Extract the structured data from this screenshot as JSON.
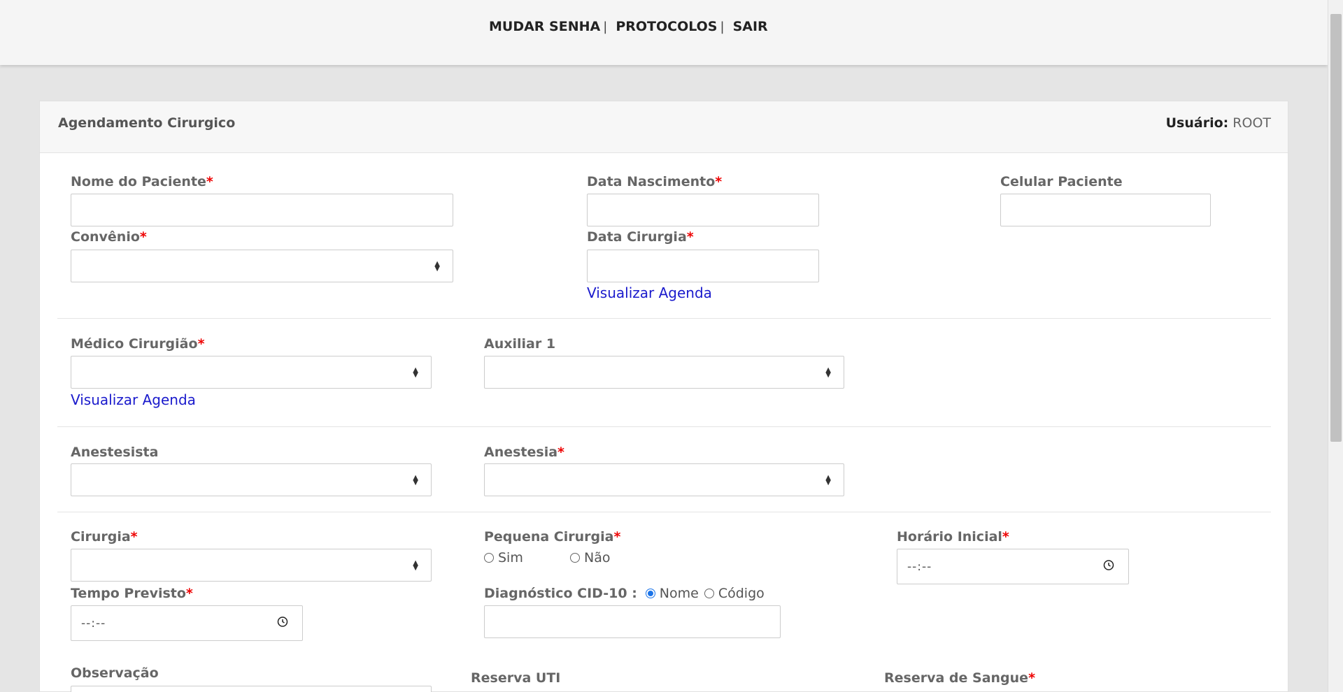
{
  "nav": {
    "change_password": "MUDAR SENHA",
    "protocols": "PROTOCOLOS",
    "logout": "SAIR",
    "separator": "|"
  },
  "header": {
    "title": "Agendamento Cirurgico",
    "user_label": "Usuário:",
    "user_value": "ROOT"
  },
  "form": {
    "patient_name": "Nome do Paciente",
    "birth_date": "Data Nascimento",
    "patient_phone": "Celular Paciente",
    "insurance": "Convênio",
    "surgery_date": "Data Cirurgia",
    "view_schedule_1": "Visualizar Agenda",
    "surgeon": "Médico Cirurgião",
    "assistant1": "Auxiliar 1",
    "view_schedule_2": "Visualizar Agenda",
    "anesthetist": "Anestesista",
    "anesthesia": "Anestesia",
    "surgery": "Cirurgia",
    "minor_surgery": "Pequena Cirurgia",
    "minor_yes": "Sim",
    "minor_no": "Não",
    "start_time": "Horário Inicial",
    "time_placeholder": "--:--",
    "expected_time": "Tempo Previsto",
    "diagnosis": "Diagnóstico CID-10 :",
    "diag_name": "Nome",
    "diag_code": "Código",
    "notes": "Observação",
    "icu_reserve": "Reserva UTI",
    "blood_reserve": "Reserva de Sangue",
    "required_mark": "*"
  },
  "colors": {
    "required": "#e00000",
    "link": "#1a1acc",
    "radio_checked": "#1a73e8"
  }
}
